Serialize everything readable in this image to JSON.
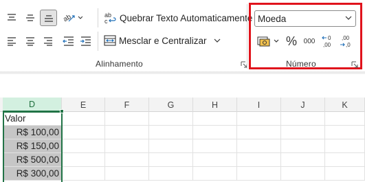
{
  "ribbon": {
    "wrap_text_label": "Quebrar Texto Automaticamente",
    "merge_center_label": "Mesclar e Centralizar",
    "alignment_group_label": "Alinhamento",
    "number_group_label": "Número",
    "number_format_value": "Moeda",
    "thousands_label": "000"
  },
  "grid": {
    "columns": [
      "D",
      "E",
      "F",
      "G",
      "H",
      "I",
      "J",
      "K"
    ],
    "rows": [
      {
        "d": "Valor"
      },
      {
        "d": "R$ 100,00"
      },
      {
        "d": "R$ 150,00"
      },
      {
        "d": "R$ 500,00"
      },
      {
        "d": "R$ 300,00"
      }
    ]
  },
  "colors": {
    "highlight_box": "#e0131c",
    "selection_green": "#217346",
    "selected_cell_fill": "#c6c6c6"
  }
}
